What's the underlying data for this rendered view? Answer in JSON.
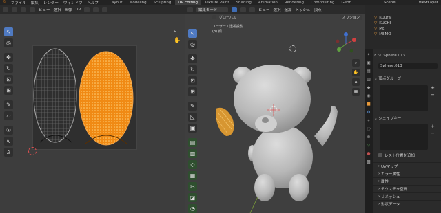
{
  "menu": [
    "ファイル",
    "編集",
    "レンダー",
    "ウィンドウ",
    "ヘルプ"
  ],
  "workspace_tabs": [
    "Layout",
    "Modeling",
    "Sculpting",
    "UV Editing",
    "Texture Paint",
    "Shading",
    "Animation",
    "Rendering",
    "Compositing",
    "Geon"
  ],
  "active_tab": "UV Editing",
  "scene": {
    "scene_name": "Scene",
    "view_layer": "ViewLayer"
  },
  "uv_editor": {
    "header": [
      "ビュー",
      "選択",
      "画像",
      "UV"
    ]
  },
  "viewport": {
    "mode": "編集モード",
    "header": [
      "ビュー",
      "選択",
      "追加",
      "メッシュ",
      "頂点"
    ],
    "global": "グローバル",
    "overlay_title": "ユーザー・透視投影",
    "overlay_sub": "(8) 顔",
    "options": "オプション"
  },
  "outliner": {
    "items": [
      {
        "name": "KOural"
      },
      {
        "name": "KUCHI"
      },
      {
        "name": "ME"
      },
      {
        "name": "MEMO"
      }
    ]
  },
  "properties": {
    "object_name": "Sphere.013",
    "data_name": "Sphere.013",
    "vertex_groups": "頂点グループ",
    "shape_keys": "シェイプキー",
    "relative_label": "レスト位置を追加",
    "sections": [
      "UVマップ",
      "カラー属性",
      "属性",
      "テクスチャ空間",
      "リメッシュ",
      "形状データ"
    ]
  },
  "colors": {
    "accent": "#4f7ac2",
    "selection": "#f08a14",
    "mesh": "#a8a8a8"
  }
}
